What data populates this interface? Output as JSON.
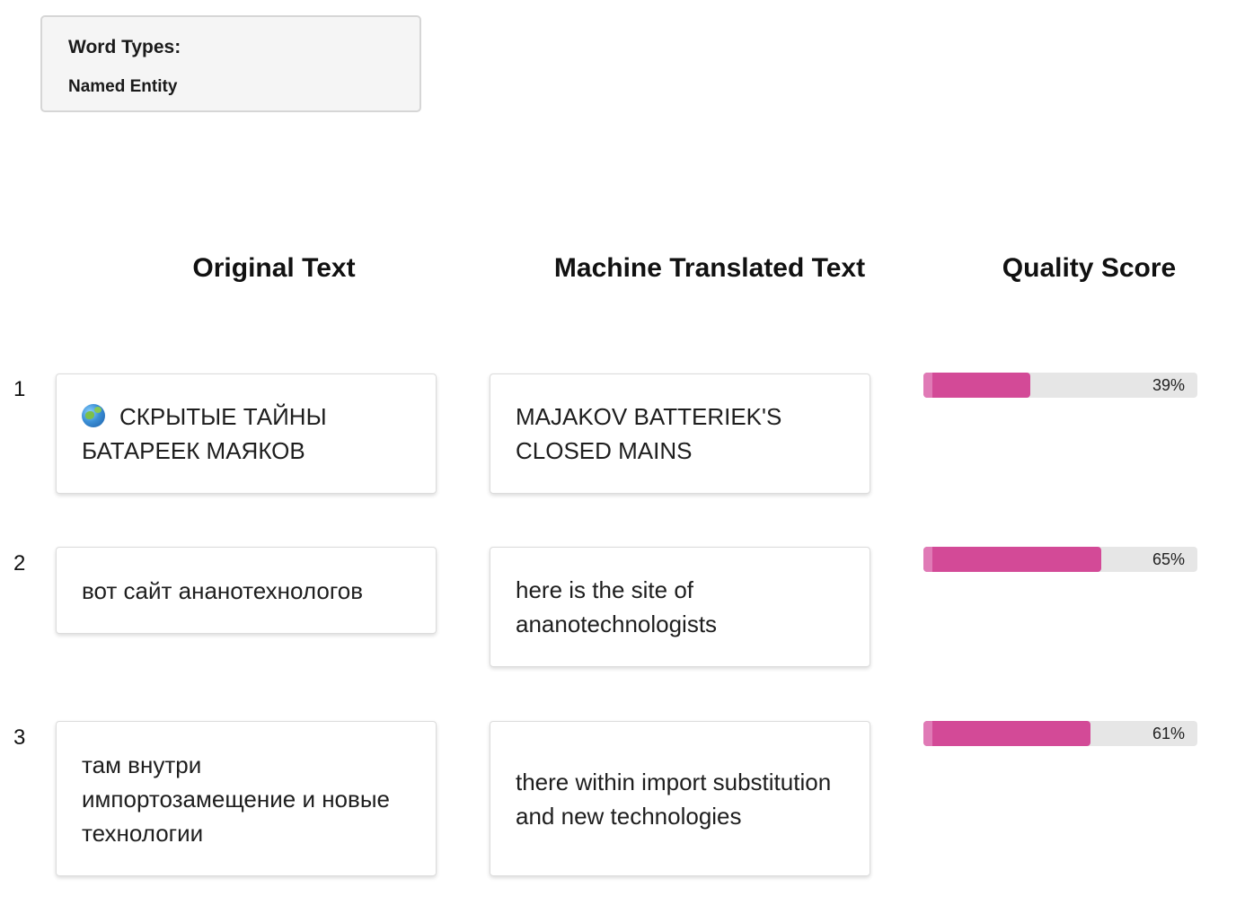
{
  "word_types": {
    "title": "Word Types:",
    "item": "Named Entity"
  },
  "headers": {
    "original": "Original Text",
    "machine_translated": "Machine Translated Text",
    "quality": "Quality Score"
  },
  "rows": [
    {
      "number": "1",
      "icon": "globe-icon",
      "original": "СКРЫТЫЕ ТАЙНЫ БАТАРЕЕК МАЯКОВ",
      "translated": "MAJAKOV BATTERIEK'S CLOSED MAINS",
      "score": 39,
      "score_label": "39%"
    },
    {
      "number": "2",
      "original": "вот сайт ананотехнологов",
      "translated": "here is the site of ananotechnologists",
      "score": 65,
      "score_label": "65%"
    },
    {
      "number": "3",
      "original": "там внутри импортозамещение и новые технологии",
      "translated": "there within import substitution and new technologies",
      "score": 61,
      "score_label": "61%"
    }
  ],
  "colors": {
    "bar_fill": "#d34a97",
    "bar_track": "#e6e6e6"
  }
}
